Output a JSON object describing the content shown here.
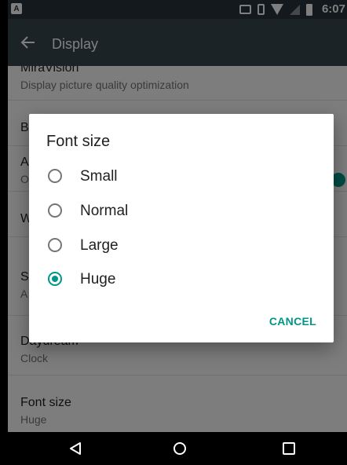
{
  "status_bar": {
    "notification_icon": "A",
    "icons": [
      "cast-icon",
      "vibrate-icon",
      "wifi-icon",
      "signal-icon",
      "battery-icon"
    ],
    "time": "6:07"
  },
  "app_bar": {
    "title": "Display",
    "back_icon": "arrow-back-icon"
  },
  "settings_list": [
    {
      "title": "MiraVision",
      "subtitle": "Display picture quality optimization"
    },
    {
      "title": "B",
      "subtitle": ""
    },
    {
      "title": "A",
      "subtitle": "O"
    },
    {
      "title": "W",
      "subtitle": ""
    },
    {
      "title": "S",
      "subtitle": "A"
    },
    {
      "title": "Daydream",
      "subtitle": "Clock"
    },
    {
      "title": "Font size",
      "subtitle": "Huge"
    }
  ],
  "dialog": {
    "title": "Font size",
    "options": [
      {
        "label": "Small",
        "selected": false
      },
      {
        "label": "Normal",
        "selected": false
      },
      {
        "label": "Large",
        "selected": false
      },
      {
        "label": "Huge",
        "selected": true
      }
    ],
    "cancel_label": "CANCEL"
  },
  "nav_bar": {
    "icons": [
      "back-triangle-icon",
      "home-circle-icon",
      "recents-square-icon"
    ]
  },
  "colors": {
    "status_bar": "#263238",
    "app_bar": "#37474f",
    "accent": "#009688"
  }
}
